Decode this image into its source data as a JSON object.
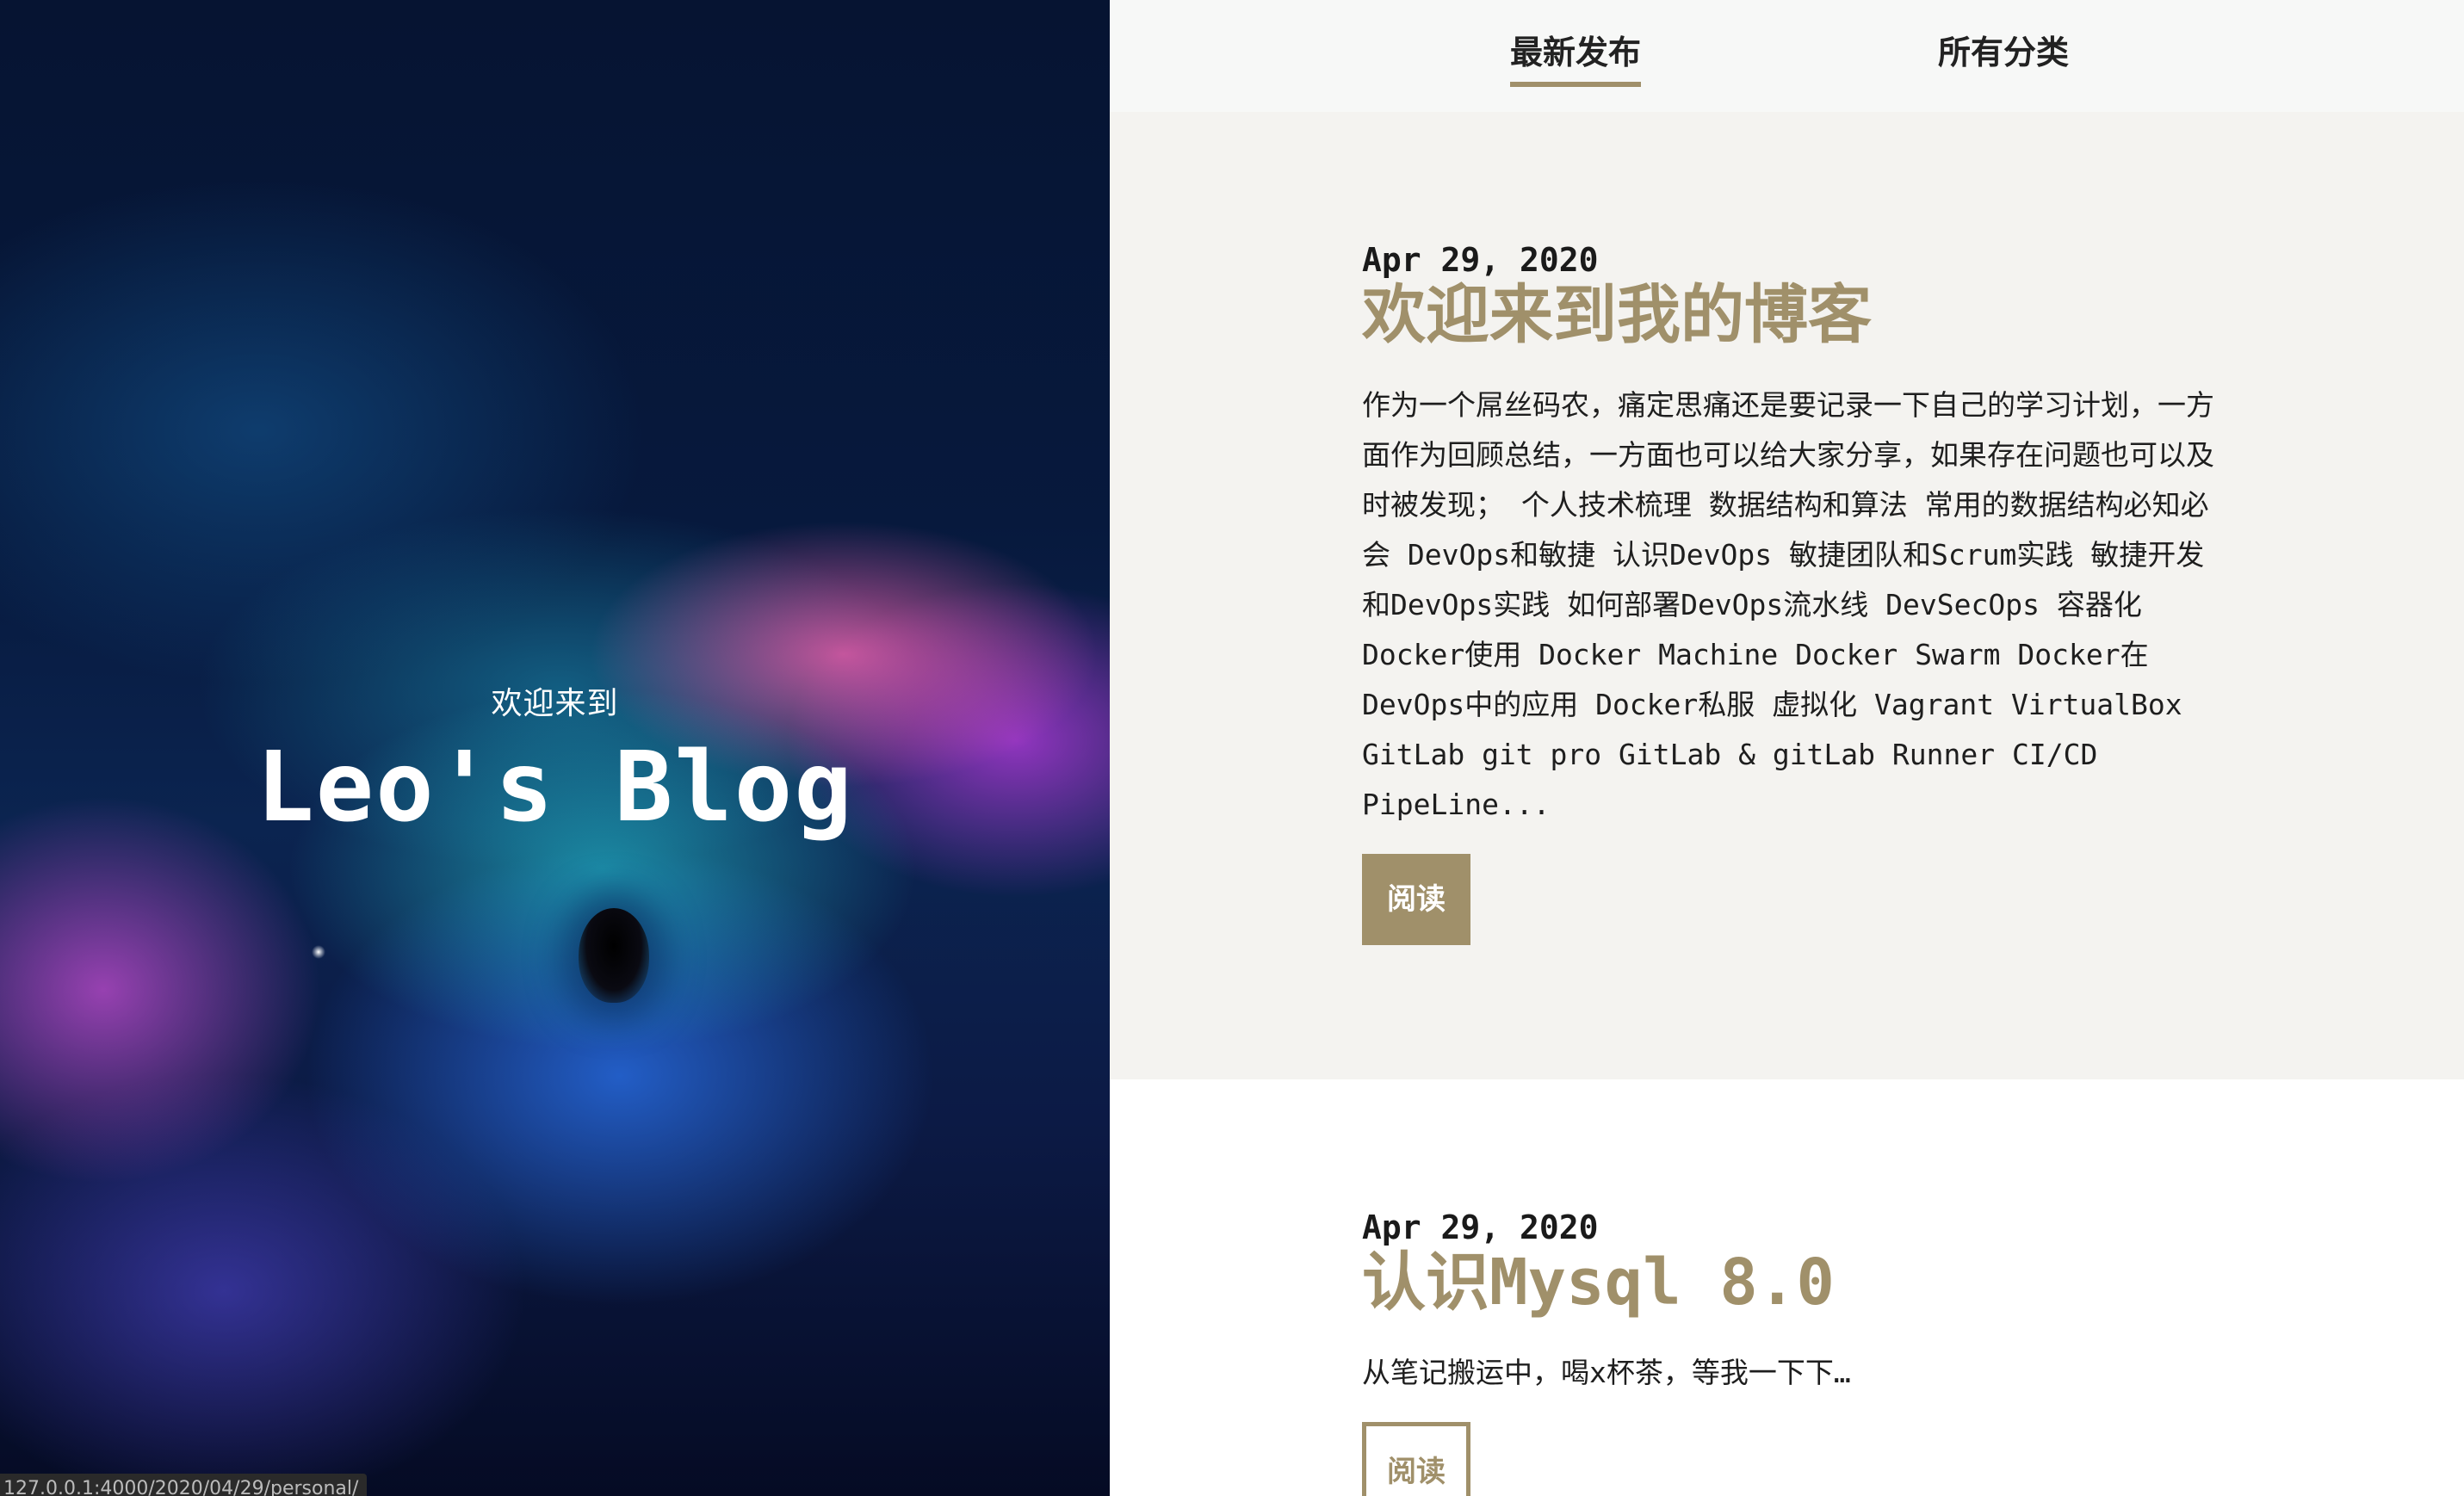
{
  "hero": {
    "welcome": "欢迎来到",
    "title": "Leo's Blog",
    "status_url": "127.0.0.1:4000/2020/04/29/personal/"
  },
  "nav": {
    "tabs": [
      {
        "label": "最新发布",
        "active": true
      },
      {
        "label": "所有分类",
        "active": false
      }
    ]
  },
  "posts": [
    {
      "date": "Apr 29, 2020",
      "title": "欢迎来到我的博客",
      "excerpt": "作为一个屌丝码农，痛定思痛还是要记录一下自己的学习计划，一方面作为回顾总结，一方面也可以给大家分享，如果存在问题也可以及时被发现； 个人技术梳理 数据结构和算法 常用的数据结构必知必会 DevOps和敏捷 认识DevOps 敏捷团队和Scrum实践 敏捷开发和DevOps实践 如何部署DevOps流水线 DevSecOps 容器化 Docker使用 Docker Machine Docker Swarm Docker在DevOps中的应用 Docker私服 虚拟化 Vagrant VirtualBox GitLab git pro GitLab & gitLab Runner CI/CD PipeLine...",
      "read_label": "阅读"
    },
    {
      "date": "Apr 29, 2020",
      "title": "认识Mysql 8.0",
      "excerpt": "从笔记搬运中，喝x杯茶，等我一下下…",
      "read_label": "阅读"
    }
  ],
  "colors": {
    "accent": "#a0906a",
    "post_bg_alt": "#f4f3f0",
    "nav_bg": "#f7f8f7"
  }
}
